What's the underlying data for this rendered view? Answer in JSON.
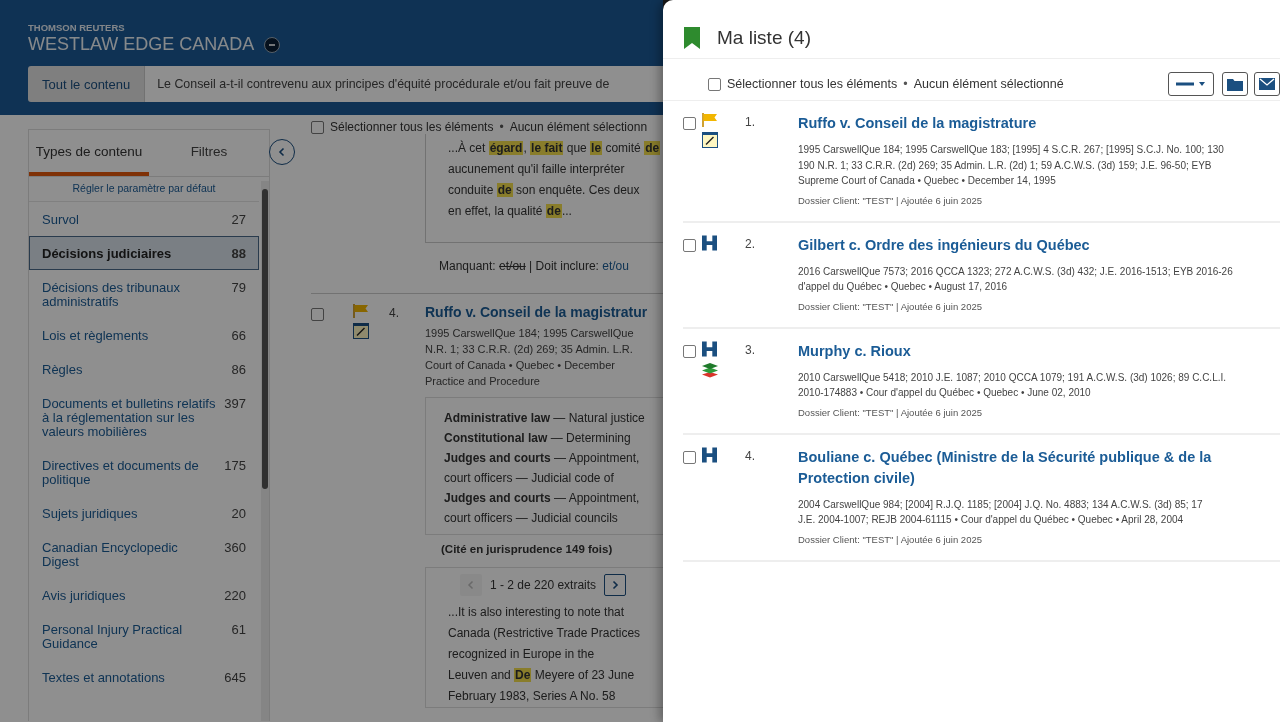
{
  "page": {
    "header": {
      "company": "THOMSON REUTERS",
      "product": "WESTLAW EDGE CANADA"
    },
    "search": {
      "scope": "Tout le contenu",
      "value": "Le Conseil a-t-il contrevenu aux principes d'équité procédurale et/ou fait preuve de"
    },
    "filter_panel": {
      "tabs": [
        {
          "label": "Types de contenu",
          "selected": true
        },
        {
          "label": "Filtres",
          "selected": false
        }
      ],
      "reset_link": "Régler le paramètre par défaut",
      "items": [
        {
          "label": "Survol",
          "count": "27",
          "selected": false
        },
        {
          "label": "Décisions judiciaires",
          "count": "88",
          "selected": true
        },
        {
          "label": "Décisions des tribunaux administratifs",
          "count": "79",
          "selected": false
        },
        {
          "label": "Lois et règlements",
          "count": "66",
          "selected": false
        },
        {
          "label": "Règles",
          "count": "86",
          "selected": false
        },
        {
          "label": "Documents et bulletins relatifs à la réglementation sur les valeurs mobilières",
          "count": "397",
          "selected": false
        },
        {
          "label": "Directives et documents de politique",
          "count": "175",
          "selected": false
        },
        {
          "label": "Sujets juridiques",
          "count": "20",
          "selected": false
        },
        {
          "label": "Canadian Encyclopedic Digest",
          "count": "360",
          "selected": false
        },
        {
          "label": "Avis juridiques",
          "count": "220",
          "selected": false
        },
        {
          "label": "Personal Injury Practical Guidance",
          "count": "61",
          "selected": false
        },
        {
          "label": "Textes et annotations",
          "count": "645",
          "selected": false
        }
      ]
    },
    "results": {
      "select_all": {
        "label": "Sélectionner tous les éléments",
        "checked": false
      },
      "separator": "•",
      "selection_status": "Aucun élément sélectionn",
      "snippet": [
        "...À cet **égard**, **le fait** que **le** comité **de**",
        "aucunement qu'il faille interpréter",
        "conduite **de** son enquête. Ces deux",
        "en effet, la qualité **de**..."
      ],
      "missing_terms": {
        "missing_label": "Manquant:",
        "missing_term": "et/ou",
        "include_label": "| Doit inclure:",
        "include_term": "et/ou"
      },
      "result": {
        "checked": false,
        "flagged": true,
        "annotated": true,
        "number": "4.",
        "title": "Ruffo v. Conseil de la magistratur",
        "citation_lines": [
          "1995 CarswellQue 184; 1995 CarswellQue",
          "N.R. 1; 33 C.R.R. (2d) 269; 35 Admin. L.R.",
          "Court of Canada • Quebec • December",
          "Practice and Procedure"
        ],
        "headnotes": [
          "**Administrative law** — Natural justice",
          "**Constitutional law** — Determining",
          "**Judges and courts** — Appointment,",
          "court officers — Judicial code of",
          "**Judges and courts** — Appointment,",
          "court officers — Judicial councils"
        ],
        "cited": "(Cité en jurisprudence 149 fois)",
        "excerpts": {
          "prev_disabled": true,
          "label": "1 - 2 de 220 extraits",
          "next_disabled": false,
          "lines": [
            "...It is also interesting to note that",
            "Canada (Restrictive Trade Practices",
            "recognized in Europe in the",
            "Leuven and **De** Meyere of 23 June",
            "February 1983, Series A No. 58"
          ]
        }
      }
    }
  },
  "drawer": {
    "title": "Ma liste (4)",
    "select_all": {
      "label": "Sélectionner tous les éléments",
      "checked": false
    },
    "separator": "•",
    "selection_status": "Aucun élément sélectionné",
    "items": [
      {
        "checked": false,
        "flagged": true,
        "annotated": true,
        "history": false,
        "stacked": false,
        "number": "1.",
        "title": "Ruffo v. Conseil de la magistrature",
        "citation_lines": [
          "1995 CarswellQue 184; 1995 CarswellQue 183; [1995] 4 S.C.R. 267; [1995] S.C.J. No. 100; 130",
          "190 N.R. 1; 33 C.R.R. (2d) 269; 35 Admin. L.R. (2d) 1; 59 A.C.W.S. (3d) 159; J.E. 96-50; EYB",
          "Supreme Court of Canada • Quebec • December 14, 1995"
        ],
        "note": "Dossier Client: \"TEST\" | Ajoutée 6 juin 2025"
      },
      {
        "checked": false,
        "flagged": false,
        "annotated": false,
        "history": true,
        "stacked": false,
        "number": "2.",
        "title": "Gilbert c. Ordre des ingénieurs du Québec",
        "citation_lines": [
          "2016 CarswellQue 7573; 2016 QCCA 1323; 272 A.C.W.S. (3d) 432; J.E. 2016-1513; EYB 2016-26",
          "d'appel du Québec • Quebec • August 17, 2016"
        ],
        "note": "Dossier Client: \"TEST\" | Ajoutée 6 juin 2025"
      },
      {
        "checked": false,
        "flagged": false,
        "annotated": false,
        "history": true,
        "stacked": true,
        "number": "3.",
        "title": "Murphy c. Rioux",
        "citation_lines": [
          "2010 CarswellQue 5418; 2010 J.E. 1087; 2010 QCCA 1079; 191 A.C.W.S. (3d) 1026; 89 C.C.L.I.",
          "2010-174883 • Cour d'appel du Québec • Quebec • June 02, 2010"
        ],
        "note": "Dossier Client: \"TEST\" | Ajoutée 6 juin 2025"
      },
      {
        "checked": false,
        "flagged": false,
        "annotated": false,
        "history": true,
        "stacked": false,
        "number": "4.",
        "title": "Bouliane c. Québec (Ministre de la Sécurité publique & de la Protection civile)",
        "citation_lines": [
          "2004 CarswellQue 984; [2004] R.J.Q. 1185; [2004] J.Q. No. 4883; 134 A.C.W.S. (3d) 85; 17",
          "J.E. 2004-1007; REJB 2004-61115 • Cour d'appel du Québec • Quebec • April 28, 2004"
        ],
        "note": "Dossier Client: \"TEST\" | Ajoutée 6 juin 2025"
      }
    ]
  }
}
